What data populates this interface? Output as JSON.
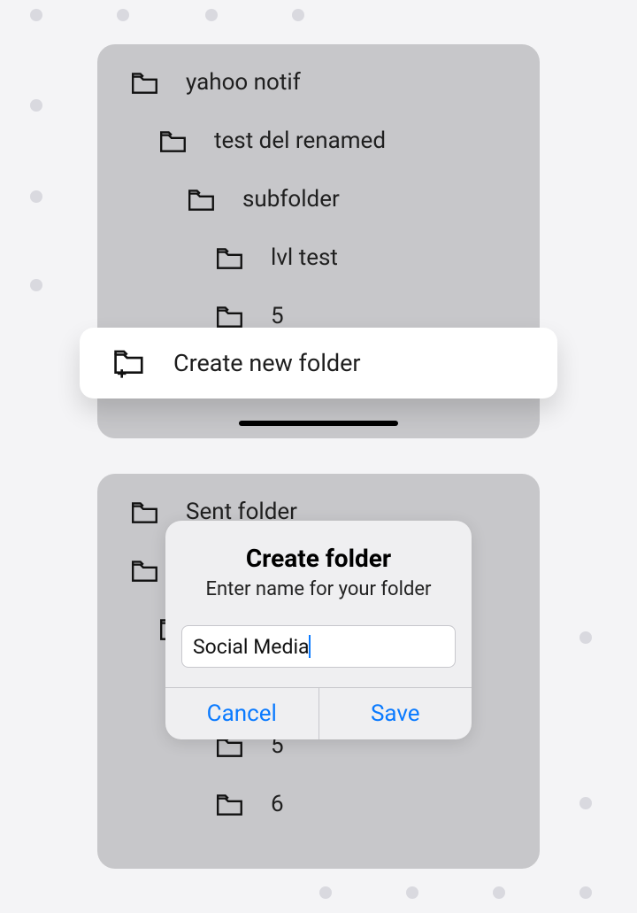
{
  "top_tree": [
    {
      "label": "yahoo notif",
      "indent": 0
    },
    {
      "label": "test del renamed",
      "indent": 1
    },
    {
      "label": "subfolder",
      "indent": 2
    },
    {
      "label": "lvl test",
      "indent": 3
    },
    {
      "label": "5",
      "indent": 3
    }
  ],
  "action_label": "Create new folder",
  "bottom_tree": [
    {
      "label": "Sent folder",
      "indent": 0
    },
    {
      "label": "",
      "indent": 0
    },
    {
      "label": "",
      "indent": 1
    },
    {
      "label": "",
      "indent": 3
    },
    {
      "label": "5",
      "indent": 3
    },
    {
      "label": "6",
      "indent": 3
    }
  ],
  "dialog": {
    "title": "Create folder",
    "subtitle": "Enter name for your folder",
    "input_value": "Social Media",
    "cancel": "Cancel",
    "save": "Save"
  }
}
